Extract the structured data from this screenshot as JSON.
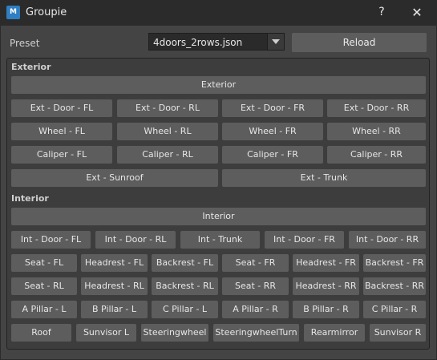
{
  "window": {
    "title": "Groupie",
    "help": "?",
    "close": "✕",
    "icon_text": "M"
  },
  "preset": {
    "label": "Preset",
    "value": "4doors_2rows.json",
    "reload": "Reload"
  },
  "exterior": {
    "section": "Exterior",
    "all": "Exterior",
    "rows": [
      [
        "Ext - Door - FL",
        "Ext - Door - RL",
        "Ext - Door - FR",
        "Ext - Door - RR"
      ],
      [
        "Wheel - FL",
        "Wheel - RL",
        "Wheel - FR",
        "Wheel - RR"
      ],
      [
        "Caliper - FL",
        "Caliper - RL",
        "Caliper - FR",
        "Caliper - RR"
      ],
      [
        "Ext - Sunroof",
        "Ext - Trunk"
      ]
    ]
  },
  "interior": {
    "section": "Interior",
    "all": "Interior",
    "rows": [
      [
        "Int - Door - FL",
        "Int - Door - RL",
        "Int - Trunk",
        "Int - Door - FR",
        "Int - Door - RR"
      ],
      [
        "Seat - FL",
        "Headrest - FL",
        "Backrest - FL",
        "Seat - FR",
        "Headrest - FR",
        "Backrest - FR"
      ],
      [
        "Seat - RL",
        "Headrest - RL",
        "Backrest - RL",
        "Seat - RR",
        "Headrest - RR",
        "Backrest - RR"
      ],
      [
        "A Pillar - L",
        "B Pillar - L",
        "C Pillar - L",
        "A Pillar - R",
        "B Pillar - R",
        "C Pillar - R"
      ],
      [
        "Roof",
        "Sunvisor L",
        "Steeringwheel",
        "SteeringwheelTurn",
        "Rearmirror",
        "Sunvisor R"
      ]
    ]
  }
}
